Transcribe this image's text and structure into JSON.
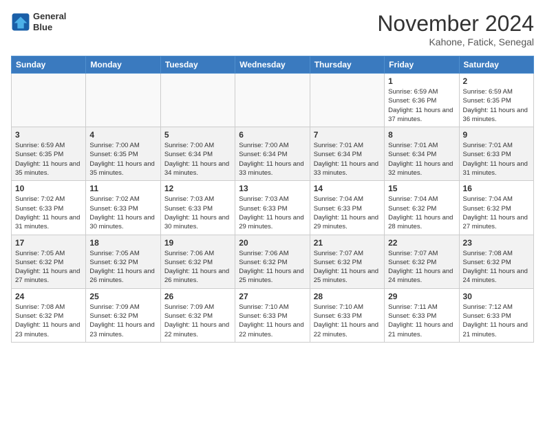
{
  "header": {
    "logo_line1": "General",
    "logo_line2": "Blue",
    "month": "November 2024",
    "location": "Kahone, Fatick, Senegal"
  },
  "weekdays": [
    "Sunday",
    "Monday",
    "Tuesday",
    "Wednesday",
    "Thursday",
    "Friday",
    "Saturday"
  ],
  "weeks": [
    [
      {
        "day": "",
        "info": ""
      },
      {
        "day": "",
        "info": ""
      },
      {
        "day": "",
        "info": ""
      },
      {
        "day": "",
        "info": ""
      },
      {
        "day": "",
        "info": ""
      },
      {
        "day": "1",
        "info": "Sunrise: 6:59 AM\nSunset: 6:36 PM\nDaylight: 11 hours\nand 37 minutes."
      },
      {
        "day": "2",
        "info": "Sunrise: 6:59 AM\nSunset: 6:35 PM\nDaylight: 11 hours\nand 36 minutes."
      }
    ],
    [
      {
        "day": "3",
        "info": "Sunrise: 6:59 AM\nSunset: 6:35 PM\nDaylight: 11 hours\nand 35 minutes."
      },
      {
        "day": "4",
        "info": "Sunrise: 7:00 AM\nSunset: 6:35 PM\nDaylight: 11 hours\nand 35 minutes."
      },
      {
        "day": "5",
        "info": "Sunrise: 7:00 AM\nSunset: 6:34 PM\nDaylight: 11 hours\nand 34 minutes."
      },
      {
        "day": "6",
        "info": "Sunrise: 7:00 AM\nSunset: 6:34 PM\nDaylight: 11 hours\nand 33 minutes."
      },
      {
        "day": "7",
        "info": "Sunrise: 7:01 AM\nSunset: 6:34 PM\nDaylight: 11 hours\nand 33 minutes."
      },
      {
        "day": "8",
        "info": "Sunrise: 7:01 AM\nSunset: 6:34 PM\nDaylight: 11 hours\nand 32 minutes."
      },
      {
        "day": "9",
        "info": "Sunrise: 7:01 AM\nSunset: 6:33 PM\nDaylight: 11 hours\nand 31 minutes."
      }
    ],
    [
      {
        "day": "10",
        "info": "Sunrise: 7:02 AM\nSunset: 6:33 PM\nDaylight: 11 hours\nand 31 minutes."
      },
      {
        "day": "11",
        "info": "Sunrise: 7:02 AM\nSunset: 6:33 PM\nDaylight: 11 hours\nand 30 minutes."
      },
      {
        "day": "12",
        "info": "Sunrise: 7:03 AM\nSunset: 6:33 PM\nDaylight: 11 hours\nand 30 minutes."
      },
      {
        "day": "13",
        "info": "Sunrise: 7:03 AM\nSunset: 6:33 PM\nDaylight: 11 hours\nand 29 minutes."
      },
      {
        "day": "14",
        "info": "Sunrise: 7:04 AM\nSunset: 6:33 PM\nDaylight: 11 hours\nand 29 minutes."
      },
      {
        "day": "15",
        "info": "Sunrise: 7:04 AM\nSunset: 6:32 PM\nDaylight: 11 hours\nand 28 minutes."
      },
      {
        "day": "16",
        "info": "Sunrise: 7:04 AM\nSunset: 6:32 PM\nDaylight: 11 hours\nand 27 minutes."
      }
    ],
    [
      {
        "day": "17",
        "info": "Sunrise: 7:05 AM\nSunset: 6:32 PM\nDaylight: 11 hours\nand 27 minutes."
      },
      {
        "day": "18",
        "info": "Sunrise: 7:05 AM\nSunset: 6:32 PM\nDaylight: 11 hours\nand 26 minutes."
      },
      {
        "day": "19",
        "info": "Sunrise: 7:06 AM\nSunset: 6:32 PM\nDaylight: 11 hours\nand 26 minutes."
      },
      {
        "day": "20",
        "info": "Sunrise: 7:06 AM\nSunset: 6:32 PM\nDaylight: 11 hours\nand 25 minutes."
      },
      {
        "day": "21",
        "info": "Sunrise: 7:07 AM\nSunset: 6:32 PM\nDaylight: 11 hours\nand 25 minutes."
      },
      {
        "day": "22",
        "info": "Sunrise: 7:07 AM\nSunset: 6:32 PM\nDaylight: 11 hours\nand 24 minutes."
      },
      {
        "day": "23",
        "info": "Sunrise: 7:08 AM\nSunset: 6:32 PM\nDaylight: 11 hours\nand 24 minutes."
      }
    ],
    [
      {
        "day": "24",
        "info": "Sunrise: 7:08 AM\nSunset: 6:32 PM\nDaylight: 11 hours\nand 23 minutes."
      },
      {
        "day": "25",
        "info": "Sunrise: 7:09 AM\nSunset: 6:32 PM\nDaylight: 11 hours\nand 23 minutes."
      },
      {
        "day": "26",
        "info": "Sunrise: 7:09 AM\nSunset: 6:32 PM\nDaylight: 11 hours\nand 22 minutes."
      },
      {
        "day": "27",
        "info": "Sunrise: 7:10 AM\nSunset: 6:33 PM\nDaylight: 11 hours\nand 22 minutes."
      },
      {
        "day": "28",
        "info": "Sunrise: 7:10 AM\nSunset: 6:33 PM\nDaylight: 11 hours\nand 22 minutes."
      },
      {
        "day": "29",
        "info": "Sunrise: 7:11 AM\nSunset: 6:33 PM\nDaylight: 11 hours\nand 21 minutes."
      },
      {
        "day": "30",
        "info": "Sunrise: 7:12 AM\nSunset: 6:33 PM\nDaylight: 11 hours\nand 21 minutes."
      }
    ]
  ]
}
